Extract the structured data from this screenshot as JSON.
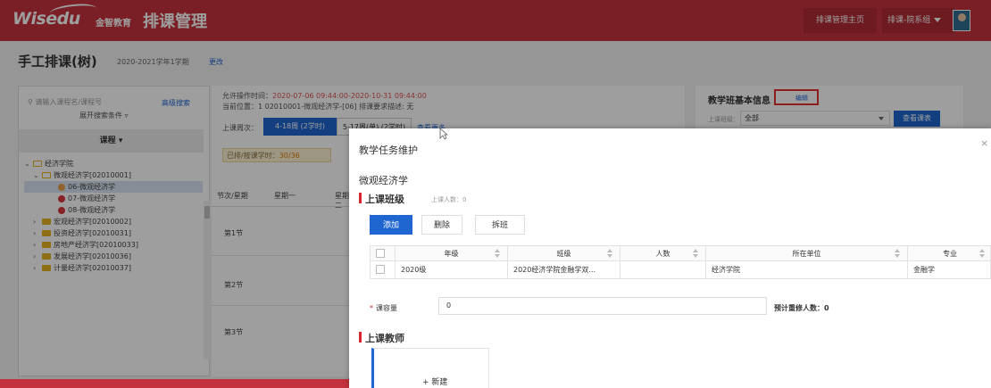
{
  "header": {
    "logo_text": "Wisedu",
    "logo_cn": "金智教育",
    "app_title": "排课管理",
    "home_link": "排课管理主页",
    "user_role": "排课-院系组"
  },
  "page": {
    "title": "手工排课(树)",
    "term": "2020-2021学年1学期",
    "change_link": "更改"
  },
  "left_panel": {
    "search_placeholder": "请输入课程名/课程号",
    "advanced_search": "高级搜索",
    "expand_conditions": "展开搜索条件",
    "course_header": "课程",
    "tree": [
      "经济学院",
      "微观经济学[02010001]",
      "06-微观经济学",
      "07-微观经济学",
      "08-微观经济学",
      "宏观经济学[02010002]",
      "投资经济学[02010031]",
      "房地产经济学[02010033]",
      "发展经济学[02010036]",
      "计量经济学[02010037]"
    ]
  },
  "middle_panel": {
    "op_time_label": "允许操作时间：",
    "op_time_value": "2020-07-06 09:44:00-2020-10-31 09:44:00",
    "location": "当前位置：1  02010001-微观经济学-[06]  排课要求描述: 无",
    "weeks_label": "上课周次：",
    "week_tab1": "4-18周 (2学时)",
    "week_tab2": "5-17周(单) (2学时)",
    "week_more": "查看更多",
    "hours_label": "已排/按课学时：",
    "hours_value": "30/36",
    "grid_col1": "节次/星期",
    "grid_col2": "星期一",
    "grid_col3": "星期二",
    "slots": [
      "第1节",
      "第2节",
      "第3节"
    ]
  },
  "right_panel": {
    "title": "教学班基本信息",
    "edit_link": "编辑",
    "class_label": "上课班级：",
    "class_value": "全部",
    "view_button": "查看课表"
  },
  "modal": {
    "title": "教学任务维护",
    "close": "×",
    "course_name": "微观经济学",
    "section_class": "上课班级",
    "class_count_label": "上课人数：0",
    "btn_add": "添加",
    "btn_delete": "删除",
    "btn_split": "拆班",
    "table": {
      "headers": [
        "年级",
        "班级",
        "人数",
        "所在单位",
        "专业"
      ],
      "rows": [
        [
          "2020级",
          "2020经济学院金融学双...",
          "",
          "经济学院",
          "金融学"
        ]
      ]
    },
    "capacity_required": "*",
    "capacity_label": "课容量",
    "capacity_value": "0",
    "retake_label": "预计重修人数：0",
    "section_teacher": "上课教师",
    "new_teacher": "+ 新建"
  },
  "colors": {
    "brand_red": "#c4323d",
    "primary_blue": "#1f66d1",
    "highlight_red": "#e3312f"
  }
}
